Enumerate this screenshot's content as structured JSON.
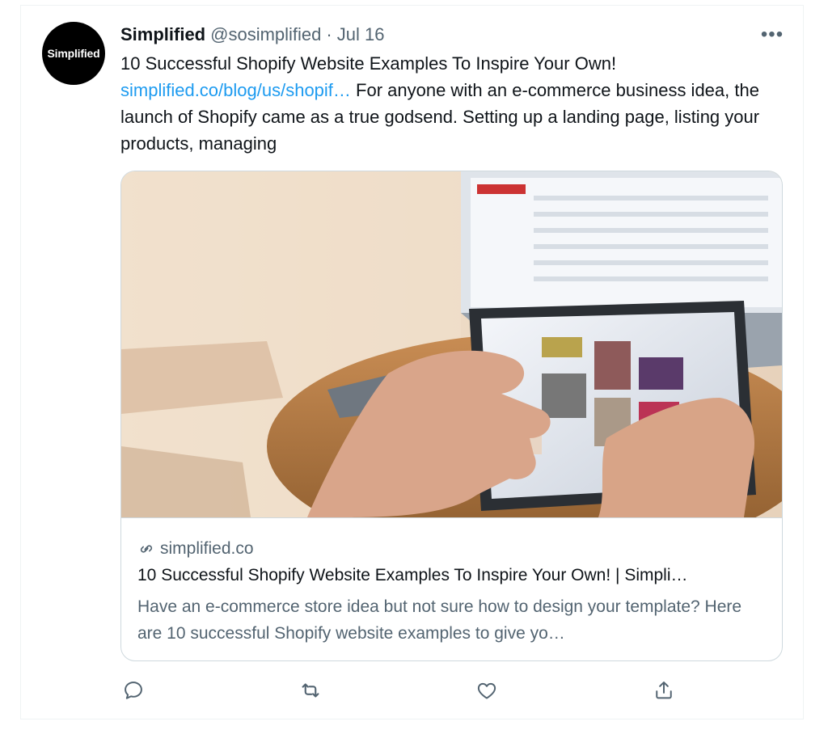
{
  "tweet": {
    "author_name": "Simplified",
    "author_handle": "@sosimplified",
    "separator": "·",
    "date": "Jul 16",
    "avatar_text": "Simplified",
    "more_label": "•••",
    "text_line1": "10 Successful Shopify Website Examples To Inspire Your Own!",
    "link_text": "simplified.co/blog/us/shopif…",
    "text_rest": " For anyone with an e-commerce business idea, the launch of Shopify came as a true godsend. Setting up a landing page, listing your products, managing"
  },
  "card": {
    "domain": "simplified.co",
    "title": "10 Successful Shopify Website Examples To Inspire Your Own! | Simpli…",
    "description": "Have an e-commerce store idea but not sure how to design your template? Here are 10 successful Shopify website examples to give yo…"
  },
  "actions": [
    {
      "icon": "reply-icon"
    },
    {
      "icon": "retweet-icon"
    },
    {
      "icon": "like-icon"
    },
    {
      "icon": "share-icon"
    }
  ],
  "colors": {
    "link": "#1d9bf0",
    "secondary_text": "#536471",
    "border": "#cfd9de"
  }
}
